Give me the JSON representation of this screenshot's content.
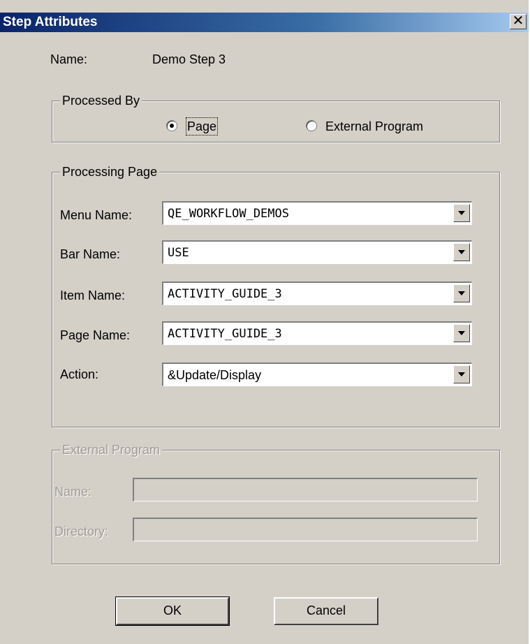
{
  "window": {
    "title": "Step Attributes",
    "close_glyph": "✕"
  },
  "name_row": {
    "label": "Name:",
    "value": "Demo Step 3"
  },
  "processed_by": {
    "legend": "Processed By",
    "options": [
      {
        "label": "Page",
        "selected": true
      },
      {
        "label": "External Program",
        "selected": false
      }
    ]
  },
  "processing_page": {
    "legend": "Processing Page",
    "fields": [
      {
        "label": "Menu Name:",
        "value": "QE_WORKFLOW_DEMOS"
      },
      {
        "label": "Bar Name:",
        "value": "USE"
      },
      {
        "label": "Item Name:",
        "value": "ACTIVITY_GUIDE_3"
      },
      {
        "label": "Page Name:",
        "value": "ACTIVITY_GUIDE_3"
      },
      {
        "label": "Action:",
        "value": "&Update/Display"
      }
    ]
  },
  "external_program": {
    "legend": "External Program",
    "name_label": "Name:",
    "name_value": "",
    "directory_label": "Directory:",
    "directory_value": "",
    "enabled": false
  },
  "buttons": {
    "ok": "OK",
    "cancel": "Cancel"
  },
  "colors": {
    "face": "#d4d0c8",
    "title_start": "#0a246a",
    "title_end": "#a6caf0",
    "disabled_text": "#a09c94"
  }
}
